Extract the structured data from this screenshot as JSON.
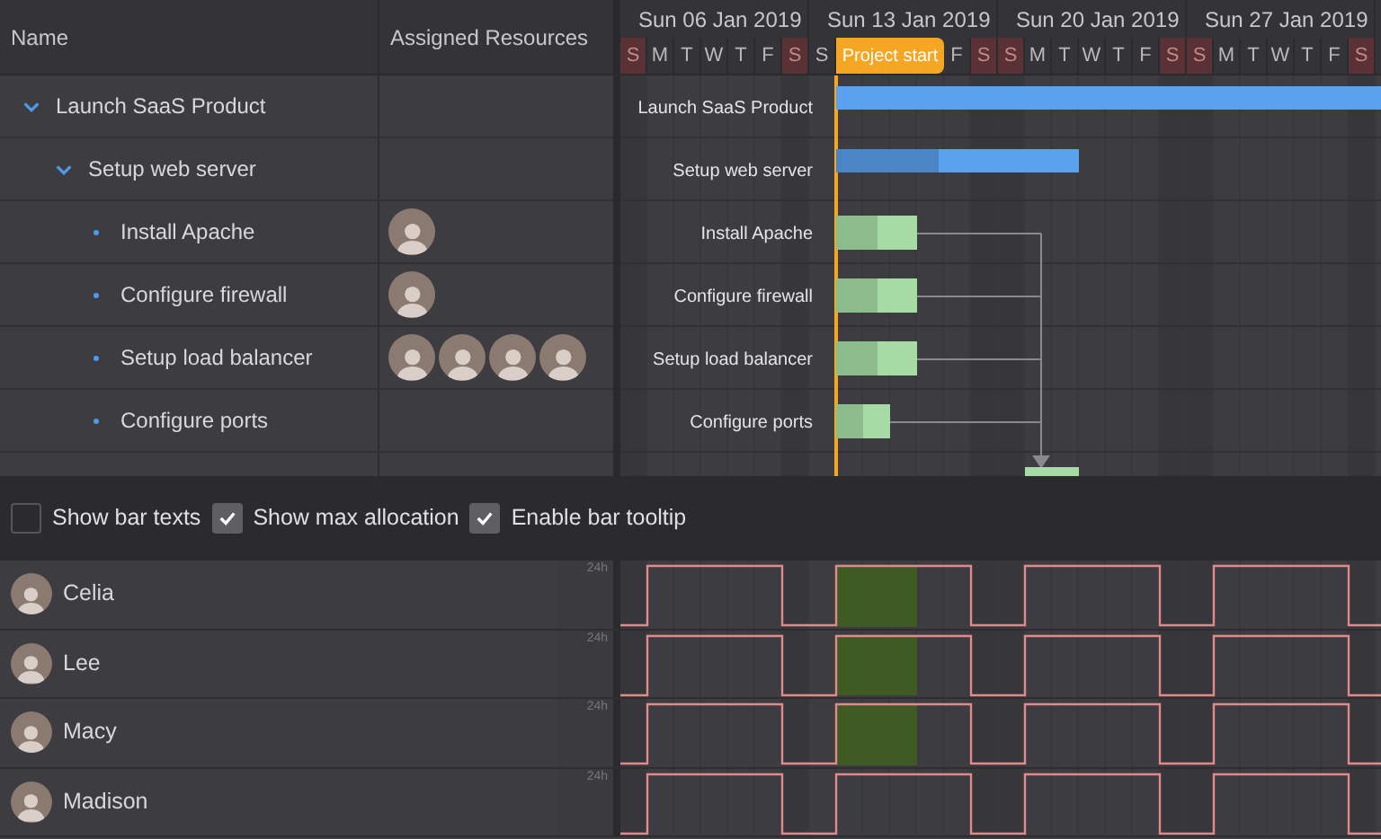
{
  "columns": [
    "Name",
    "Assigned Resources"
  ],
  "weeks": [
    "Sun 06 Jan 2019",
    "Sun 13 Jan 2019",
    "Sun 20 Jan 2019",
    "Sun 27 Jan 2019"
  ],
  "days": [
    {
      "kind": "day",
      "letter": "S",
      "weekend": true
    },
    {
      "kind": "day",
      "letter": "M",
      "weekend": false
    },
    {
      "kind": "day",
      "letter": "T",
      "weekend": false
    },
    {
      "kind": "day",
      "letter": "W",
      "weekend": false
    },
    {
      "kind": "day",
      "letter": "T",
      "weekend": false
    },
    {
      "kind": "day",
      "letter": "F",
      "weekend": false
    },
    {
      "kind": "day",
      "letter": "S",
      "weekend": true
    },
    {
      "kind": "day",
      "letter": "S",
      "weekend": false
    },
    {
      "kind": "marker",
      "label": "Project start"
    },
    {
      "kind": "day",
      "letter": "F",
      "weekend": false
    },
    {
      "kind": "day",
      "letter": "S",
      "weekend": true
    },
    {
      "kind": "day",
      "letter": "S",
      "weekend": true
    },
    {
      "kind": "day",
      "letter": "M",
      "weekend": false
    },
    {
      "kind": "day",
      "letter": "T",
      "weekend": false
    },
    {
      "kind": "day",
      "letter": "W",
      "weekend": false
    },
    {
      "kind": "day",
      "letter": "T",
      "weekend": false
    },
    {
      "kind": "day",
      "letter": "F",
      "weekend": false
    },
    {
      "kind": "day",
      "letter": "S",
      "weekend": true
    },
    {
      "kind": "day",
      "letter": "S",
      "weekend": true
    },
    {
      "kind": "day",
      "letter": "M",
      "weekend": false
    },
    {
      "kind": "day",
      "letter": "T",
      "weekend": false
    },
    {
      "kind": "day",
      "letter": "W",
      "weekend": false
    },
    {
      "kind": "day",
      "letter": "T",
      "weekend": false
    },
    {
      "kind": "day",
      "letter": "F",
      "weekend": false
    },
    {
      "kind": "day",
      "letter": "S",
      "weekend": true
    }
  ],
  "tasks": [
    {
      "name": "Launch SaaS Product",
      "bar_label": "Launch SaaS Product",
      "kind": "summary",
      "expanded": true,
      "children": [
        {
          "name": "Setup web server",
          "bar_label": "Setup web server",
          "kind": "summary",
          "expanded": true,
          "level": 0.42,
          "children": [
            {
              "name": "Install Apache",
              "bar_label": "Install Apache",
              "kind": "task",
              "level": 0.5,
              "assignees": [
                {
                  "kind": "photo"
                }
              ]
            },
            {
              "name": "Configure firewall",
              "bar_label": "Configure firewall",
              "kind": "task",
              "level": 0.5,
              "assignees": [
                {
                  "kind": "photo"
                }
              ]
            },
            {
              "name": "Setup load balancer",
              "bar_label": "Setup load balancer",
              "kind": "task",
              "level": 0.5,
              "assignees": [
                {
                  "kind": "photo"
                },
                {
                  "kind": "photo"
                },
                {
                  "kind": "photo"
                },
                {
                  "kind": "photo"
                }
              ]
            },
            {
              "name": "Configure ports",
              "bar_label": "Configure ports",
              "kind": "task",
              "level": 0.5
            },
            {
              "kind": "task"
            }
          ]
        }
      ]
    }
  ],
  "options": [
    {
      "label": "Show bar texts",
      "checked": false
    },
    {
      "label": "Show max allocation",
      "checked": true
    },
    {
      "label": "Enable bar tooltip",
      "checked": true
    }
  ],
  "resources": [
    {
      "name": "Celia",
      "axis_label": "24h",
      "highlighted": true
    },
    {
      "name": "Lee",
      "axis_label": "24h",
      "highlighted": true
    },
    {
      "name": "Macy",
      "axis_label": "24h",
      "highlighted": true
    },
    {
      "name": "Madison",
      "axis_label": "24h",
      "highlighted": false
    }
  ]
}
